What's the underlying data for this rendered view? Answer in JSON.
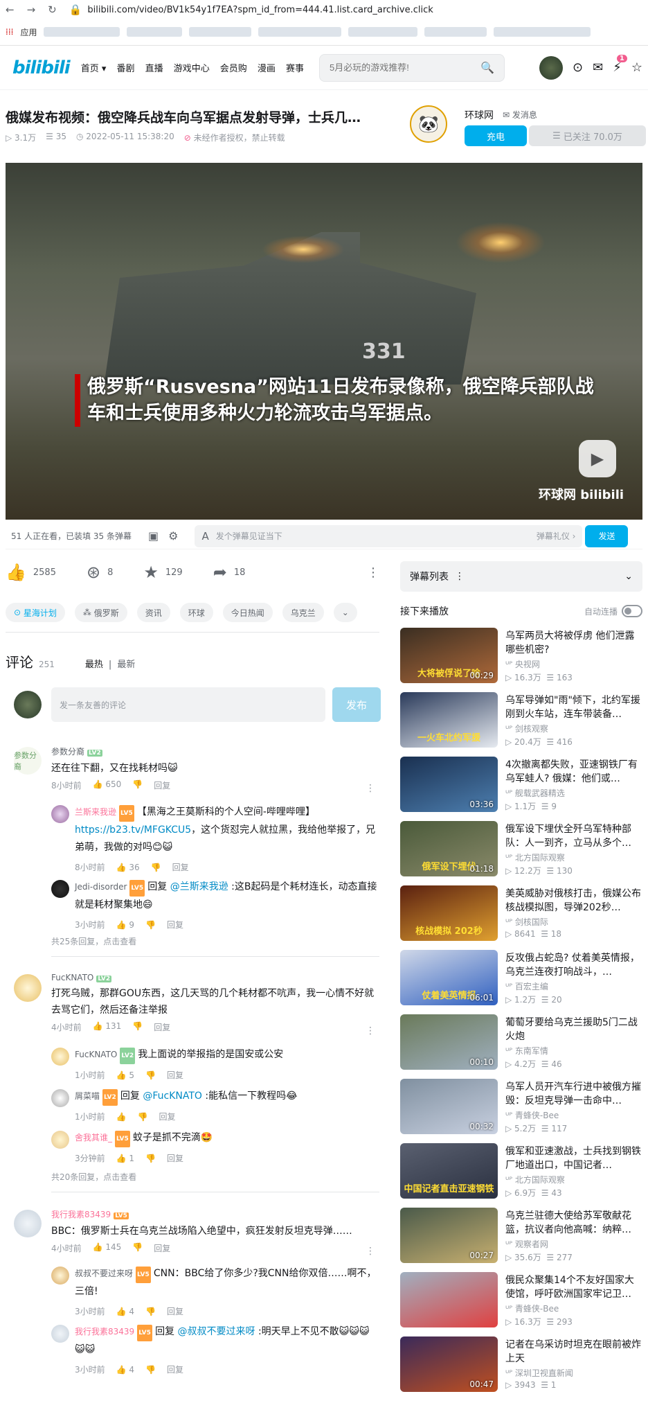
{
  "browser": {
    "url": "bilibili.com/video/BV1k54y1f7EA?spm_id_from=444.41.list.card_archive.click",
    "apps": "应用"
  },
  "nav": {
    "logo": "bilibili",
    "items": [
      "首页 ▾",
      "番剧",
      "直播",
      "游戏中心",
      "会员购",
      "漫画",
      "赛事"
    ],
    "search_placeholder": "5月必玩的游戏推荐!",
    "msg_count": "1"
  },
  "video": {
    "title": "俄媒发布视频：俄空降兵战车向乌军据点发射导弹，士兵几…",
    "views": "3.1万",
    "danmaku": "35",
    "date": "2022-05-11 15:38:20",
    "notice": "未经作者授权，禁止转载",
    "caption": "俄罗斯“Rusvesna”网站11日发布录像称，俄空降兵部队战车和士兵使用多种火力轮流攻击乌军据点。",
    "vehicle_number": "331",
    "watermark": "环球网 bilibili"
  },
  "uploader": {
    "name": "环球网",
    "msg": "发消息",
    "charge": "充电",
    "follow": "已关注 70.0万"
  },
  "danmaku_bar": {
    "watching": "51 人正在看，已装填 35 条弹幕",
    "placeholder": "发个弹幕见证当下",
    "etiquette": "弹幕礼仪 ›",
    "send": "发送"
  },
  "actions": {
    "like": "2585",
    "coin": "8",
    "fav": "129",
    "share": "18"
  },
  "tags": [
    "星海计划",
    "俄罗斯",
    "资讯",
    "环球",
    "今日热闻",
    "乌克兰"
  ],
  "comments_header": {
    "title": "评论",
    "count": "251",
    "hot": "最热",
    "new": "最新",
    "input": "发一条友善的评论",
    "publish": "发布"
  },
  "comments": [
    {
      "user": "参数分裔",
      "level": "LV2",
      "text": "还在往下翻，又在找耗材吗😺",
      "time": "8小时前",
      "likes": "650",
      "reply": "回复",
      "replies": [
        {
          "user": "兰斯来我逊",
          "level": "LV5",
          "text": "【黑海之王莫斯科的个人空间-哔哩哔哩】",
          "link": "https://b23.tv/MFGKCU5",
          "text2": "，这个货怼完人就拉黑，我给他举报了，兄弟萌，我做的对吗😊😺",
          "time": "8小时前",
          "likes": "36"
        },
        {
          "user": "Jedi-disorder",
          "level": "LV5",
          "prefix": "回复",
          "mention": "@兰斯来我逊",
          "text": " :这B起码是个耗材连长，动态直接就是耗材聚集地😄",
          "time": "3小时前",
          "likes": "9"
        }
      ],
      "more": "共25条回复，点击查看"
    },
    {
      "user": "FucKNATO",
      "level": "LV2",
      "text": "打死乌贼，那群GOU东西，这几天骂的几个耗材都不吭声，我一心情不好就去骂它们，然后还备注举报",
      "time": "4小时前",
      "likes": "131",
      "reply": "回复",
      "replies": [
        {
          "user": "FucKNATO",
          "level": "LV2",
          "text": "我上面说的举报指的是国安或公安",
          "time": "1小时前",
          "likes": "5"
        },
        {
          "user": "屑菜喵",
          "level": "LV2",
          "prefix": "回复",
          "mention": "@FucKNATO",
          "text": " :能私信一下教程吗😂",
          "time": "1小时前",
          "likes": ""
        },
        {
          "user": "舍我其谁_",
          "level": "LV5",
          "text": "蚊子是抓不完滴🤩",
          "time": "3分钟前",
          "likes": "1"
        }
      ],
      "more": "共20条回复，点击查看"
    },
    {
      "user": "我行我素83439",
      "level": "LV5",
      "text": "BBC：俄罗斯士兵在乌克兰战场陷入绝望中，疯狂发射反坦克导弹……",
      "time": "4小时前",
      "likes": "145",
      "reply": "回复",
      "replies": [
        {
          "user": "叔叔不要过来呀",
          "level": "LV5",
          "text": "CNN：BBC给了你多少?我CNN给你双倍……啊不，三倍!",
          "time": "3小时前",
          "likes": "4"
        },
        {
          "user": "我行我素83439",
          "level": "LV5",
          "prefix": "回复",
          "mention": "@叔叔不要过来呀",
          "text": " :明天早上不见不散😺😺😺😺😺",
          "time": "3小时前",
          "likes": "4"
        }
      ]
    }
  ],
  "side": {
    "danmaku_list": "弹幕列表",
    "up_next": "接下来播放",
    "autoplay": "自动连播",
    "recs": [
      {
        "title": "乌军两员大将被俘虏 他们泄露哪些机密?",
        "up": "央视网",
        "views": "16.3万",
        "dm": "163",
        "dur": "00:29",
        "ov": "大将被俘说了啥"
      },
      {
        "title": "乌军导弹如\"雨\"倾下，北约军援刚到火车站，连车带装备…",
        "up": "剑核观察",
        "views": "20.4万",
        "dm": "416",
        "dur": "",
        "ov": "一火车北约军援"
      },
      {
        "title": "4次撤离都失败，亚速钢铁厂有乌军蛙人? 俄媒：他们或…",
        "up": "舰载武器精选",
        "views": "1.1万",
        "dm": "9",
        "dur": "03:36",
        "ov": ""
      },
      {
        "title": "俄军设下埋伏全歼乌军特种部队：人一到齐，立马从多个…",
        "up": "北方国际观察",
        "views": "12.2万",
        "dm": "130",
        "dur": "01:18",
        "ov": "俄军设下埋伏"
      },
      {
        "title": "美英威胁对俄核打击，俄媒公布核战模拟图，导弹202秒…",
        "up": "剑核国际",
        "views": "8641",
        "dm": "18",
        "dur": "",
        "ov": "核战模拟 202秒"
      },
      {
        "title": "反攻俄占蛇岛? 仗着美英情报，乌克兰连夜打响战斗，…",
        "up": "百宏主编",
        "views": "1.2万",
        "dm": "20",
        "dur": "06:01",
        "ov": "仗着美英情报"
      },
      {
        "title": "葡萄牙要给乌克兰援助5门二战火炮",
        "up": "东南军情",
        "views": "4.2万",
        "dm": "46",
        "dur": "00:10",
        "ov": ""
      },
      {
        "title": "乌军人员开汽车行进中被俄方摧毁：反坦克导弹一击命中…",
        "up": "青蜂侠-Bee",
        "views": "5.2万",
        "dm": "117",
        "dur": "00:32",
        "ov": ""
      },
      {
        "title": "俄军和亚速激战，士兵找到钢铁厂地道出口，中国记者…",
        "up": "北方国际观察",
        "views": "6.9万",
        "dm": "43",
        "dur": "",
        "ov": "中国记者直击亚速钢铁"
      },
      {
        "title": "乌克兰驻德大使给苏军敬献花篮，抗议者向他高喊：纳粹…",
        "up": "观察者网",
        "views": "35.6万",
        "dm": "277",
        "dur": "00:27",
        "ov": ""
      },
      {
        "title": "俄民众聚集14个不友好国家大使馆，呼吁欧洲国家牢记卫…",
        "up": "青蜂侠-Bee",
        "views": "16.3万",
        "dm": "293",
        "dur": "",
        "ov": ""
      },
      {
        "title": "记者在乌采访时坦克在眼前被炸上天",
        "up": "深圳卫视直新闻",
        "views": "3943",
        "dm": "1",
        "dur": "00:47",
        "ov": ""
      }
    ]
  }
}
